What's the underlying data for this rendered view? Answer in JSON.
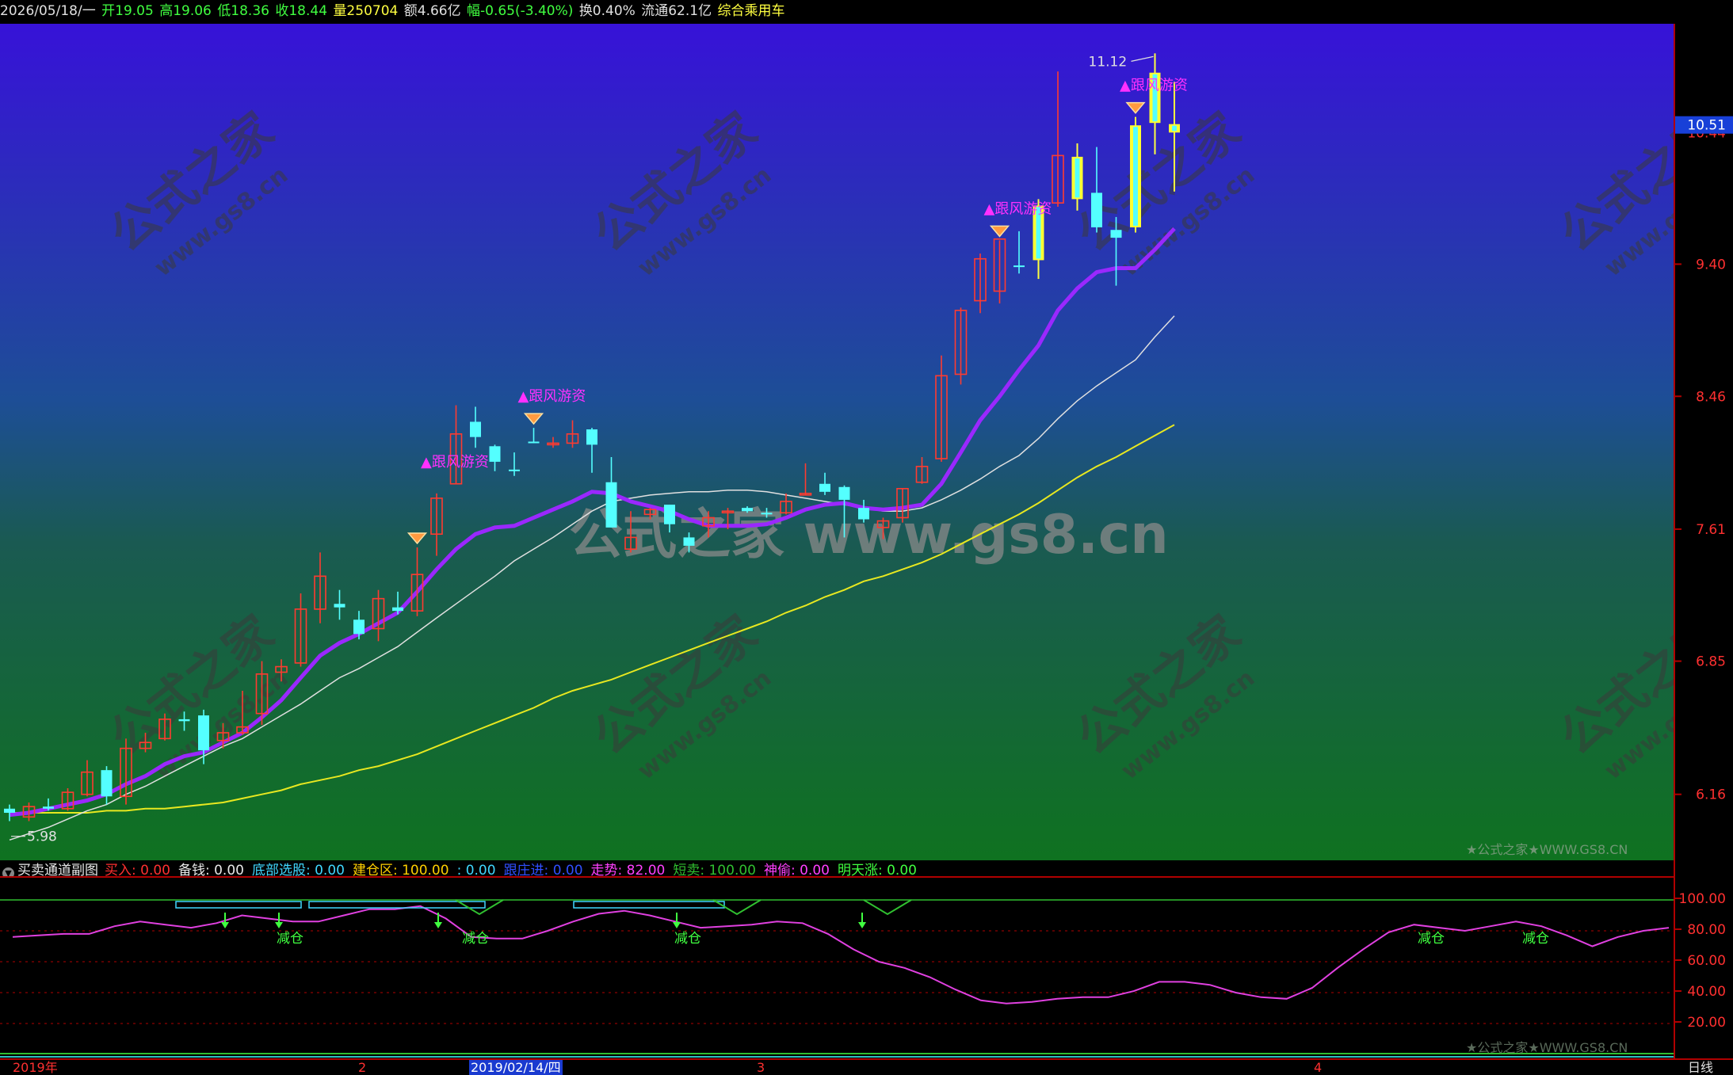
{
  "info_bar": {
    "date": "2026/05/18/一",
    "open": "开19.05",
    "high": "高19.06",
    "low": "低18.36",
    "close": "收18.44",
    "volume": "量250704",
    "amount": "额4.66亿",
    "change": "幅-0.65(-3.40%)",
    "turnover": "换0.40%",
    "float": "流通62.1亿",
    "sector": "综合乘用车"
  },
  "price_axis": {
    "labels": [
      "9.40",
      "8.46",
      "7.61",
      "6.85",
      "6.16"
    ],
    "current_price": "10.51",
    "level_label": "10.44"
  },
  "chart_marks": {
    "high_mark": "11.12",
    "low_mark": "5.98",
    "signal_label": "▲跟风游资"
  },
  "watermarks": {
    "brand": "公式之家",
    "url": "www.gs8.cn",
    "center": "公式之家 www.gs8.cn",
    "corner": "★公式之家★WWW.GS8.CN"
  },
  "indicator_header": {
    "title": "买卖通道副图",
    "items": [
      {
        "text": "买入: 0.00",
        "color": "#ff3030"
      },
      {
        "text": "备钱: 0.00",
        "color": "#e8e8e8"
      },
      {
        "text": "底部选股: 0.00",
        "color": "#40d8ff"
      },
      {
        "text": "建仓区: 100.00",
        "color": "#ffd000"
      },
      {
        "text": ": 0.00",
        "color": "#40d8ff"
      },
      {
        "text": "跟庄进: 0.00",
        "color": "#3050ff"
      },
      {
        "text": "走势: 82.00",
        "color": "#ff40ff"
      },
      {
        "text": "短卖: 100.00",
        "color": "#30c030"
      },
      {
        "text": "神偷: 0.00",
        "color": "#ff40ff"
      },
      {
        "text": "明天涨: 0.00",
        "color": "#40ff40"
      }
    ]
  },
  "indicator_axis": {
    "labels": [
      "100.00",
      "80.00",
      "60.00",
      "40.00",
      "20.00"
    ]
  },
  "indicator_marks": {
    "reduce_label": "减仓"
  },
  "bottom_bar": {
    "year_label": "2019年",
    "month_2": "2",
    "cursor_date": "2019/02/14/四",
    "month_3": "3",
    "month_4": "4",
    "period": "日线"
  },
  "colors": {
    "up_candle": "#ff3b30",
    "down_candle": "#54ffff",
    "ma_purple": "#9a28ff",
    "ma_white": "#e0e0e0",
    "ma_yellow": "#e8e820",
    "signal_magenta": "#ff30ff",
    "axis_red": "#b00000"
  },
  "chart_data": {
    "type": "candlestick",
    "ylim": [
      5.9,
      11.2
    ],
    "y_ticks": [
      6.16,
      6.85,
      7.61,
      8.46,
      9.4
    ],
    "candles": [
      {
        "o": 6.09,
        "h": 6.11,
        "l": 6.03,
        "c": 6.07
      },
      {
        "o": 6.05,
        "h": 6.12,
        "l": 6.03,
        "c": 6.1
      },
      {
        "o": 6.1,
        "h": 6.14,
        "l": 6.08,
        "c": 6.09
      },
      {
        "o": 6.09,
        "h": 6.19,
        "l": 6.08,
        "c": 6.17
      },
      {
        "o": 6.16,
        "h": 6.33,
        "l": 6.15,
        "c": 6.27
      },
      {
        "o": 6.28,
        "h": 6.3,
        "l": 6.11,
        "c": 6.15
      },
      {
        "o": 6.15,
        "h": 6.44,
        "l": 6.11,
        "c": 6.39
      },
      {
        "o": 6.39,
        "h": 6.47,
        "l": 6.37,
        "c": 6.42
      },
      {
        "o": 6.44,
        "h": 6.57,
        "l": 6.43,
        "c": 6.54
      },
      {
        "o": 6.54,
        "h": 6.58,
        "l": 6.48,
        "c": 6.53
      },
      {
        "o": 6.56,
        "h": 6.59,
        "l": 6.31,
        "c": 6.38
      },
      {
        "o": 6.43,
        "h": 6.52,
        "l": 6.39,
        "c": 6.47
      },
      {
        "o": 6.47,
        "h": 6.69,
        "l": 6.46,
        "c": 6.5
      },
      {
        "o": 6.57,
        "h": 6.85,
        "l": 6.51,
        "c": 6.78
      },
      {
        "o": 6.79,
        "h": 6.86,
        "l": 6.74,
        "c": 6.82
      },
      {
        "o": 6.84,
        "h": 7.23,
        "l": 6.82,
        "c": 7.14
      },
      {
        "o": 7.14,
        "h": 7.47,
        "l": 7.06,
        "c": 7.33
      },
      {
        "o": 7.17,
        "h": 7.25,
        "l": 7.08,
        "c": 7.15
      },
      {
        "o": 7.08,
        "h": 7.13,
        "l": 6.97,
        "c": 7.0
      },
      {
        "o": 7.03,
        "h": 7.25,
        "l": 6.96,
        "c": 7.2
      },
      {
        "o": 7.15,
        "h": 7.24,
        "l": 7.11,
        "c": 7.13
      },
      {
        "o": 7.13,
        "h": 7.5,
        "l": 7.1,
        "c": 7.34
      },
      {
        "o": 7.58,
        "h": 7.83,
        "l": 7.45,
        "c": 7.8
      },
      {
        "o": 7.89,
        "h": 8.4,
        "l": 7.89,
        "c": 8.21
      },
      {
        "o": 8.29,
        "h": 8.39,
        "l": 8.12,
        "c": 8.19
      },
      {
        "o": 8.13,
        "h": 8.14,
        "l": 7.97,
        "c": 8.03
      },
      {
        "o": 7.98,
        "h": 8.09,
        "l": 7.94,
        "c": 7.97
      },
      {
        "o": 8.16,
        "h": 8.25,
        "l": 8.15,
        "c": 8.15
      },
      {
        "o": 8.15,
        "h": 8.19,
        "l": 8.12,
        "c": 8.15
      },
      {
        "o": 8.15,
        "h": 8.3,
        "l": 8.12,
        "c": 8.21
      },
      {
        "o": 8.24,
        "h": 8.25,
        "l": 7.96,
        "c": 8.14
      },
      {
        "o": 7.9,
        "h": 8.06,
        "l": 7.62,
        "c": 7.62
      },
      {
        "o": 7.49,
        "h": 7.72,
        "l": 7.47,
        "c": 7.56
      },
      {
        "o": 7.7,
        "h": 7.74,
        "l": 7.67,
        "c": 7.73
      },
      {
        "o": 7.76,
        "h": 7.76,
        "l": 7.59,
        "c": 7.64
      },
      {
        "o": 7.56,
        "h": 7.59,
        "l": 7.47,
        "c": 7.51
      },
      {
        "o": 7.63,
        "h": 7.72,
        "l": 7.56,
        "c": 7.68
      },
      {
        "o": 7.72,
        "h": 7.74,
        "l": 7.61,
        "c": 7.72
      },
      {
        "o": 7.74,
        "h": 7.75,
        "l": 7.71,
        "c": 7.72
      },
      {
        "o": 7.71,
        "h": 7.74,
        "l": 7.68,
        "c": 7.7
      },
      {
        "o": 7.71,
        "h": 7.83,
        "l": 7.7,
        "c": 7.78
      },
      {
        "o": 7.83,
        "h": 8.02,
        "l": 7.82,
        "c": 7.83
      },
      {
        "o": 7.89,
        "h": 7.96,
        "l": 7.82,
        "c": 7.84
      },
      {
        "o": 7.87,
        "h": 7.88,
        "l": 7.56,
        "c": 7.79
      },
      {
        "o": 7.74,
        "h": 7.79,
        "l": 7.65,
        "c": 7.67
      },
      {
        "o": 7.62,
        "h": 7.68,
        "l": 7.55,
        "c": 7.66
      },
      {
        "o": 7.68,
        "h": 7.86,
        "l": 7.65,
        "c": 7.86
      },
      {
        "o": 7.9,
        "h": 8.06,
        "l": 7.89,
        "c": 8.0
      },
      {
        "o": 8.05,
        "h": 8.74,
        "l": 8.03,
        "c": 8.6
      },
      {
        "o": 8.61,
        "h": 9.08,
        "l": 8.54,
        "c": 9.06
      },
      {
        "o": 9.13,
        "h": 9.48,
        "l": 9.04,
        "c": 9.44
      },
      {
        "o": 9.2,
        "h": 9.58,
        "l": 9.11,
        "c": 9.59
      },
      {
        "o": 9.39,
        "h": 9.65,
        "l": 9.33,
        "c": 9.38
      },
      {
        "o": 9.43,
        "h": 9.9,
        "l": 9.29,
        "c": 9.85
      },
      {
        "o": 9.87,
        "h": 10.96,
        "l": 9.84,
        "c": 10.25
      },
      {
        "o": 10.24,
        "h": 10.35,
        "l": 9.81,
        "c": 9.9
      },
      {
        "o": 9.95,
        "h": 10.32,
        "l": 9.64,
        "c": 9.68
      },
      {
        "o": 9.66,
        "h": 9.76,
        "l": 9.24,
        "c": 9.6
      },
      {
        "o": 9.68,
        "h": 10.57,
        "l": 9.64,
        "c": 10.5
      },
      {
        "o": 10.52,
        "h": 11.12,
        "l": 10.26,
        "c": 10.95
      },
      {
        "o": 10.51,
        "h": 10.87,
        "l": 9.96,
        "c": 10.44
      }
    ],
    "yellow_bars": [
      53,
      55,
      58,
      59,
      60
    ],
    "signals": [
      22,
      27,
      51,
      58
    ],
    "diamonds": [
      21,
      27,
      51,
      58
    ],
    "ma_purple": [
      6.06,
      6.07,
      6.09,
      6.11,
      6.13,
      6.16,
      6.21,
      6.25,
      6.31,
      6.35,
      6.37,
      6.42,
      6.47,
      6.55,
      6.64,
      6.76,
      6.88,
      6.95,
      7.0,
      7.06,
      7.12,
      7.24,
      7.37,
      7.49,
      7.58,
      7.62,
      7.63,
      7.68,
      7.73,
      7.78,
      7.84,
      7.83,
      7.78,
      7.75,
      7.72,
      7.67,
      7.63,
      7.63,
      7.63,
      7.64,
      7.68,
      7.73,
      7.76,
      7.77,
      7.74,
      7.73,
      7.74,
      7.76,
      7.89,
      8.09,
      8.3,
      8.46,
      8.64,
      8.81,
      9.06,
      9.22,
      9.34,
      9.37,
      9.37,
      9.51,
      9.67
    ],
    "ma_white": [
      5.94,
      5.97,
      6.0,
      6.04,
      6.08,
      6.11,
      6.16,
      6.2,
      6.25,
      6.3,
      6.35,
      6.4,
      6.44,
      6.5,
      6.56,
      6.62,
      6.69,
      6.76,
      6.81,
      6.87,
      6.93,
      7.01,
      7.09,
      7.17,
      7.25,
      7.33,
      7.42,
      7.49,
      7.56,
      7.64,
      7.72,
      7.78,
      7.8,
      7.82,
      7.83,
      7.84,
      7.84,
      7.85,
      7.85,
      7.84,
      7.82,
      7.8,
      7.78,
      7.76,
      7.74,
      7.72,
      7.72,
      7.74,
      7.79,
      7.85,
      7.92,
      8.0,
      8.07,
      8.18,
      8.31,
      8.43,
      8.53,
      8.62,
      8.71,
      8.87,
      9.02
    ],
    "ma_yellow": [
      6.07,
      6.07,
      6.07,
      6.07,
      6.07,
      6.08,
      6.08,
      6.09,
      6.09,
      6.1,
      6.11,
      6.12,
      6.14,
      6.16,
      6.18,
      6.21,
      6.23,
      6.25,
      6.28,
      6.3,
      6.33,
      6.36,
      6.4,
      6.44,
      6.48,
      6.52,
      6.56,
      6.6,
      6.65,
      6.69,
      6.72,
      6.75,
      6.79,
      6.83,
      6.87,
      6.91,
      6.95,
      6.99,
      7.03,
      7.07,
      7.12,
      7.16,
      7.21,
      7.25,
      7.3,
      7.33,
      7.37,
      7.41,
      7.46,
      7.52,
      7.58,
      7.64,
      7.7,
      7.77,
      7.85,
      7.93,
      8.0,
      8.06,
      8.13,
      8.2,
      8.27
    ],
    "indicator": {
      "ylim": [
        0,
        110
      ],
      "trend": [
        76,
        77,
        78,
        78,
        83,
        86,
        84,
        82,
        85,
        90,
        88,
        86,
        86,
        90,
        94,
        94,
        96,
        88,
        76,
        75,
        75,
        80,
        86,
        91,
        93,
        90,
        86,
        82,
        83,
        84,
        86,
        85,
        78,
        68,
        60,
        56,
        50,
        42,
        35,
        33,
        34,
        36,
        37,
        37,
        41,
        47,
        47,
        45,
        40,
        37,
        36,
        43,
        56,
        68,
        79,
        84,
        82,
        80,
        83,
        86,
        83,
        77,
        70,
        76,
        80,
        82
      ]
    }
  }
}
